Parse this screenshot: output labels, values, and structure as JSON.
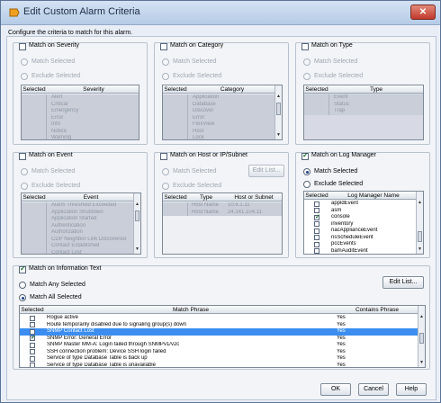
{
  "window": {
    "title": "Edit Custom Alarm Criteria",
    "close_label": "✕",
    "hint": "Configure the criteria to match for this alarm."
  },
  "common": {
    "match_selected": "Match Selected",
    "exclude_selected": "Exclude Selected",
    "selected_col": "Selected"
  },
  "severity": {
    "title": "Match on Severity",
    "col": "Severity",
    "items": [
      "Alert",
      "Critical",
      "Emergency",
      "Error",
      "Info",
      "Notice",
      "Warning"
    ]
  },
  "category": {
    "title": "Match on Category",
    "col": "Category",
    "items": [
      "Application",
      "Database",
      "Discover",
      "Error",
      "FlexView",
      "Host",
      "Lock"
    ]
  },
  "type": {
    "title": "Match on Type",
    "col": "Type",
    "items": [
      "Event",
      "Status",
      "Trap"
    ]
  },
  "event": {
    "title": "Match on Event",
    "col": "Event",
    "items": [
      "Alarm Threshold Exceeded",
      "Application Shutdown",
      "Application Started",
      "Authentication",
      "Authorization",
      "CDP Neighbor Link Discovered",
      "Contact Established",
      "Contact Lost"
    ]
  },
  "host": {
    "title": "Match on Host or IP/Subnet",
    "edit_label": "Edit List...",
    "col_type": "Type",
    "col_host": "Host or Subnet",
    "rows": [
      {
        "type": "Host Name",
        "value": "10.6.1.11"
      },
      {
        "type": "Host Name",
        "value": "24.141.104.11"
      }
    ]
  },
  "logmgr": {
    "title": "Match on Log Manager",
    "col": "Log Manager Name",
    "items": [
      {
        "name": "appldEvent",
        "checked": false
      },
      {
        "name": "asm",
        "checked": false
      },
      {
        "name": "console",
        "checked": true
      },
      {
        "name": "inventory",
        "checked": false
      },
      {
        "name": "nacApplianceEvent",
        "checked": false
      },
      {
        "name": "nsScheduleEvent",
        "checked": false
      },
      {
        "name": "pccEvents",
        "checked": false
      },
      {
        "name": "bamAuditEvent",
        "checked": false
      }
    ]
  },
  "info": {
    "title": "Match on Information Text",
    "any": "Match Any Selected",
    "all": "Match All Selected",
    "edit_label": "Edit List...",
    "col_selected": "Selected",
    "col_phrase": "Match Phrase",
    "col_contains": "Contains Phrase",
    "rows": [
      {
        "phrase": "Rogue active",
        "contains": "Yes",
        "checked": false,
        "selected": false
      },
      {
        "phrase": "Route temporarily disabled due to signaling group(s) down",
        "contains": "Yes",
        "checked": false,
        "selected": false
      },
      {
        "phrase": "SNMP Contact Lost",
        "contains": "Yes",
        "checked": false,
        "selected": true
      },
      {
        "phrase": "SNMP Error: General Error",
        "contains": "Yes",
        "checked": true,
        "selected": false
      },
      {
        "phrase": "SNMP Master MM-A: Login failed through SNMPv1/v2c",
        "contains": "Yes",
        "checked": false,
        "selected": false
      },
      {
        "phrase": "SSH connection problem: Device SSH login failed",
        "contains": "Yes",
        "checked": false,
        "selected": false
      },
      {
        "phrase": "Service of type Database Table is back up",
        "contains": "Yes",
        "checked": false,
        "selected": false
      },
      {
        "phrase": "Service of type Database Table is unavailable",
        "contains": "Yes",
        "checked": false,
        "selected": false
      }
    ]
  },
  "buttons": {
    "ok": "OK",
    "cancel": "Cancel",
    "help": "Help"
  },
  "colors": {
    "selection": "#3b8ef0",
    "title_bar": "#c7d8ee",
    "close": "#c0392b"
  }
}
